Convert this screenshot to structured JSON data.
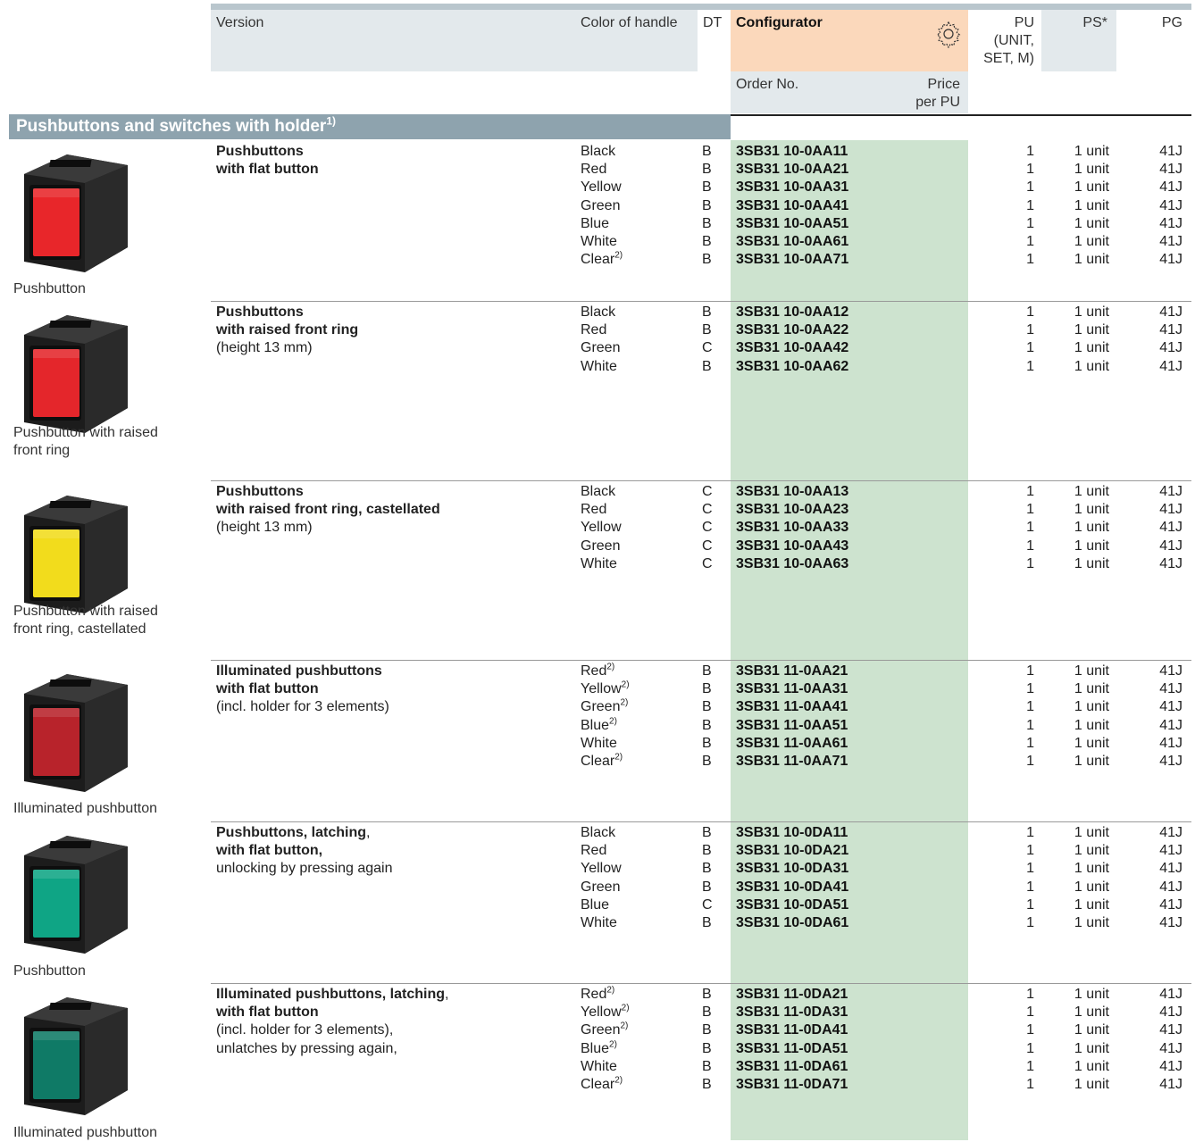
{
  "header": {
    "version": "Version",
    "color_of_handle": "Color of handle",
    "dt": "DT",
    "configurator": "Configurator",
    "order_no": "Order No.",
    "price_line1": "Price",
    "price_line2": "per PU",
    "pu_line1": "PU",
    "pu_line2": "(UNIT,",
    "pu_line3": "SET, M)",
    "ps": "PS*",
    "pg": "PG"
  },
  "section": {
    "title": "Pushbuttons and switches with holder",
    "footnote": "1)"
  },
  "groups": [
    {
      "desc_bold": [
        "Pushbuttons",
        "with flat button"
      ],
      "desc_normal": [],
      "caption": [
        "Pushbutton"
      ],
      "image_color": "#e8262a",
      "rows": [
        {
          "color": "Black",
          "sup": "",
          "dt": "B",
          "order": "3SB31 10-0AA11",
          "pu": "1",
          "ps": "1 unit",
          "pg": "41J"
        },
        {
          "color": "Red",
          "sup": "",
          "dt": "B",
          "order": "3SB31 10-0AA21",
          "pu": "1",
          "ps": "1 unit",
          "pg": "41J"
        },
        {
          "color": "Yellow",
          "sup": "",
          "dt": "B",
          "order": "3SB31 10-0AA31",
          "pu": "1",
          "ps": "1 unit",
          "pg": "41J"
        },
        {
          "color": "Green",
          "sup": "",
          "dt": "B",
          "order": "3SB31 10-0AA41",
          "pu": "1",
          "ps": "1 unit",
          "pg": "41J"
        },
        {
          "color": "Blue",
          "sup": "",
          "dt": "B",
          "order": "3SB31 10-0AA51",
          "pu": "1",
          "ps": "1 unit",
          "pg": "41J"
        },
        {
          "color": "White",
          "sup": "",
          "dt": "B",
          "order": "3SB31 10-0AA61",
          "pu": "1",
          "ps": "1 unit",
          "pg": "41J"
        },
        {
          "color": "Clear",
          "sup": "2)",
          "dt": "B",
          "order": "3SB31 10-0AA71",
          "pu": "1",
          "ps": "1 unit",
          "pg": "41J"
        }
      ]
    },
    {
      "desc_bold": [
        "Pushbuttons",
        "with raised front ring"
      ],
      "desc_normal": [
        "(height 13 mm)"
      ],
      "caption": [
        "Pushbutton with raised",
        "front ring"
      ],
      "image_color": "#e4262b",
      "rows": [
        {
          "color": "Black",
          "sup": "",
          "dt": "B",
          "order": "3SB31 10-0AA12",
          "pu": "1",
          "ps": "1 unit",
          "pg": "41J"
        },
        {
          "color": "Red",
          "sup": "",
          "dt": "B",
          "order": "3SB31 10-0AA22",
          "pu": "1",
          "ps": "1 unit",
          "pg": "41J"
        },
        {
          "color": "Green",
          "sup": "",
          "dt": "C",
          "order": "3SB31 10-0AA42",
          "pu": "1",
          "ps": "1 unit",
          "pg": "41J"
        },
        {
          "color": "White",
          "sup": "",
          "dt": "B",
          "order": "3SB31 10-0AA62",
          "pu": "1",
          "ps": "1 unit",
          "pg": "41J"
        }
      ]
    },
    {
      "desc_bold": [
        "Pushbuttons",
        "with raised front ring, castellated"
      ],
      "desc_normal": [
        "(height 13 mm)"
      ],
      "caption": [
        "Pushbutton with raised",
        "front ring, castellated"
      ],
      "image_color": "#f2dc1c",
      "rows": [
        {
          "color": "Black",
          "sup": "",
          "dt": "C",
          "order": "3SB31 10-0AA13",
          "pu": "1",
          "ps": "1 unit",
          "pg": "41J"
        },
        {
          "color": "Red",
          "sup": "",
          "dt": "C",
          "order": "3SB31 10-0AA23",
          "pu": "1",
          "ps": "1 unit",
          "pg": "41J"
        },
        {
          "color": "Yellow",
          "sup": "",
          "dt": "C",
          "order": "3SB31 10-0AA33",
          "pu": "1",
          "ps": "1 unit",
          "pg": "41J"
        },
        {
          "color": "Green",
          "sup": "",
          "dt": "C",
          "order": "3SB31 10-0AA43",
          "pu": "1",
          "ps": "1 unit",
          "pg": "41J"
        },
        {
          "color": "White",
          "sup": "",
          "dt": "C",
          "order": "3SB31 10-0AA63",
          "pu": "1",
          "ps": "1 unit",
          "pg": "41J"
        }
      ]
    },
    {
      "desc_bold": [
        "Illuminated pushbuttons",
        "with flat button"
      ],
      "desc_normal": [
        "(incl. holder for 3 elements)"
      ],
      "caption": [
        "Illuminated pushbutton"
      ],
      "image_color": "#b8232b",
      "rows": [
        {
          "color": "Red",
          "sup": "2)",
          "dt": "B",
          "order": "3SB31 11-0AA21",
          "pu": "1",
          "ps": "1 unit",
          "pg": "41J"
        },
        {
          "color": "Yellow",
          "sup": "2)",
          "dt": "B",
          "order": "3SB31 11-0AA31",
          "pu": "1",
          "ps": "1 unit",
          "pg": "41J"
        },
        {
          "color": "Green",
          "sup": "2)",
          "dt": "B",
          "order": "3SB31 11-0AA41",
          "pu": "1",
          "ps": "1 unit",
          "pg": "41J"
        },
        {
          "color": "Blue",
          "sup": "2)",
          "dt": "B",
          "order": "3SB31 11-0AA51",
          "pu": "1",
          "ps": "1 unit",
          "pg": "41J"
        },
        {
          "color": "White",
          "sup": "",
          "dt": "B",
          "order": "3SB31 11-0AA61",
          "pu": "1",
          "ps": "1 unit",
          "pg": "41J"
        },
        {
          "color": "Clear",
          "sup": "2)",
          "dt": "B",
          "order": "3SB31 11-0AA71",
          "pu": "1",
          "ps": "1 unit",
          "pg": "41J"
        }
      ]
    },
    {
      "desc_bold": [
        "Pushbuttons, latching",
        "with flat button,"
      ],
      "desc_bold_suffix": [
        ",",
        ""
      ],
      "desc_normal": [
        "unlocking by pressing again"
      ],
      "caption": [
        "Pushbutton"
      ],
      "image_color": "#0fa585",
      "rows": [
        {
          "color": "Black",
          "sup": "",
          "dt": "B",
          "order": "3SB31 10-0DA11",
          "pu": "1",
          "ps": "1 unit",
          "pg": "41J"
        },
        {
          "color": "Red",
          "sup": "",
          "dt": "B",
          "order": "3SB31 10-0DA21",
          "pu": "1",
          "ps": "1 unit",
          "pg": "41J"
        },
        {
          "color": "Yellow",
          "sup": "",
          "dt": "B",
          "order": "3SB31 10-0DA31",
          "pu": "1",
          "ps": "1 unit",
          "pg": "41J"
        },
        {
          "color": "Green",
          "sup": "",
          "dt": "B",
          "order": "3SB31 10-0DA41",
          "pu": "1",
          "ps": "1 unit",
          "pg": "41J"
        },
        {
          "color": "Blue",
          "sup": "",
          "dt": "C",
          "order": "3SB31 10-0DA51",
          "pu": "1",
          "ps": "1 unit",
          "pg": "41J"
        },
        {
          "color": "White",
          "sup": "",
          "dt": "B",
          "order": "3SB31 10-0DA61",
          "pu": "1",
          "ps": "1 unit",
          "pg": "41J"
        }
      ]
    },
    {
      "desc_bold": [
        "Illuminated pushbuttons, latching",
        "with flat button"
      ],
      "desc_bold_suffix": [
        ",",
        ""
      ],
      "desc_normal": [
        "(incl. holder for 3 elements),",
        "unlatches by pressing again,"
      ],
      "caption": [
        "Illuminated pushbutton"
      ],
      "image_color": "#0f7a66",
      "rows": [
        {
          "color": "Red",
          "sup": "2)",
          "dt": "B",
          "order": "3SB31 11-0DA21",
          "pu": "1",
          "ps": "1 unit",
          "pg": "41J"
        },
        {
          "color": "Yellow",
          "sup": "2)",
          "dt": "B",
          "order": "3SB31 11-0DA31",
          "pu": "1",
          "ps": "1 unit",
          "pg": "41J"
        },
        {
          "color": "Green",
          "sup": "2)",
          "dt": "B",
          "order": "3SB31 11-0DA41",
          "pu": "1",
          "ps": "1 unit",
          "pg": "41J"
        },
        {
          "color": "Blue",
          "sup": "2)",
          "dt": "B",
          "order": "3SB31 11-0DA51",
          "pu": "1",
          "ps": "1 unit",
          "pg": "41J"
        },
        {
          "color": "White",
          "sup": "",
          "dt": "B",
          "order": "3SB31 11-0DA61",
          "pu": "1",
          "ps": "1 unit",
          "pg": "41J"
        },
        {
          "color": "Clear",
          "sup": "2)",
          "dt": "B",
          "order": "3SB31 11-0DA71",
          "pu": "1",
          "ps": "1 unit",
          "pg": "41J"
        }
      ]
    }
  ]
}
